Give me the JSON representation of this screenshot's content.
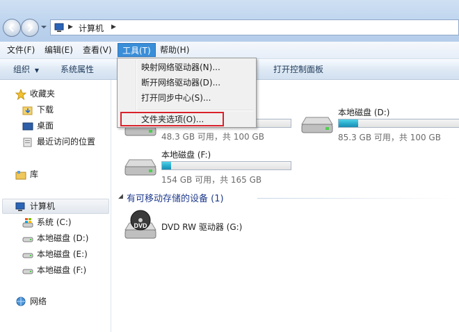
{
  "address": {
    "crumb": "计算机"
  },
  "menubar": {
    "file": "文件(F)",
    "edit": "编辑(E)",
    "view": "查看(V)",
    "tools": "工具(T)",
    "help": "帮助(H)"
  },
  "toolbar": {
    "organize": "组织",
    "system_properties": "系统属性",
    "open_control_panel": "打开控制面板"
  },
  "nav": {
    "favorites": "收藏夹",
    "downloads": "下载",
    "desktop": "桌面",
    "recent": "最近访问的位置",
    "libraries": "库",
    "computer": "计算机",
    "system_c": "系统 (C:)",
    "local_d": "本地磁盘 (D:)",
    "local_e": "本地磁盘 (E:)",
    "local_f": "本地磁盘 (F:)",
    "network": "网络"
  },
  "drives": {
    "c": {
      "info": "48.3 GB 可用，共 100 GB",
      "used_fraction": 0.52
    },
    "d": {
      "name": "本地磁盘 (D:)",
      "info": "85.3 GB 可用，共 100 GB",
      "used_fraction": 0.15
    },
    "f": {
      "name": "本地磁盘 (F:)",
      "info": "154 GB 可用，共 165 GB",
      "used_fraction": 0.07
    }
  },
  "removable": {
    "section_title": "有可移动存储的设备 (1)",
    "dvd_name": "DVD RW 驱动器 (G:)"
  },
  "tools_menu": {
    "map_drive": "映射网络驱动器(N)...",
    "disconnect_drive": "断开网络驱动器(D)...",
    "sync_center": "打开同步中心(S)...",
    "folder_options": "文件夹选项(O)..."
  },
  "colors": {
    "menu_highlight": "#3a8ed8",
    "annotation_box": "#d9212b",
    "drive_bar": "#26a6c9"
  }
}
